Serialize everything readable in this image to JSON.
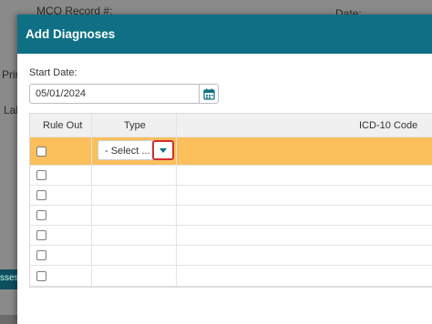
{
  "background": {
    "mco_label": "MCO Record #:",
    "date_label": "Date:",
    "prim_fragment": "Prim",
    "lab_fragment": "Lab",
    "tab_fragment": "sses"
  },
  "modal": {
    "title": "Add Diagnoses",
    "start_date_label": "Start Date:",
    "start_date_value": "05/01/2024"
  },
  "grid": {
    "columns": [
      "Rule Out",
      "Type",
      "ICD-10 Code"
    ],
    "type_select_value": "- Select ..."
  },
  "colors": {
    "header_bar": "#0f7085",
    "selected_row": "#fbbf5b",
    "highlight_border": "#d32f2f"
  }
}
